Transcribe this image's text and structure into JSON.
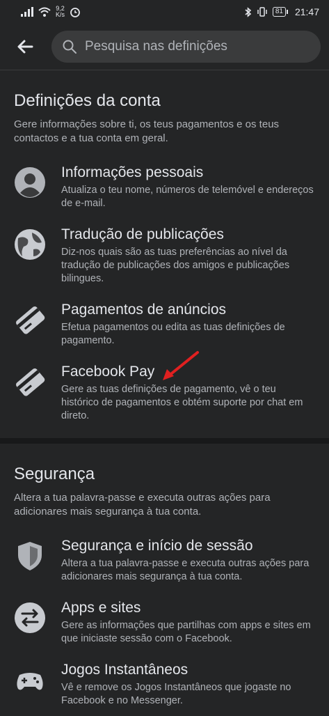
{
  "status": {
    "speed_top": "9,2",
    "speed_bottom": "K/s",
    "battery": "81",
    "time": "21:47"
  },
  "search": {
    "placeholder": "Pesquisa nas definições"
  },
  "sections": [
    {
      "title": "Definições da conta",
      "desc": "Gere informações sobre ti, os teus pagamentos e os teus contactos e a tua conta em geral.",
      "items": [
        {
          "title": "Informações pessoais",
          "desc": "Atualiza o teu nome, números de telemóvel e endereços de e-mail.",
          "icon": "person-icon"
        },
        {
          "title": "Tradução de publicações",
          "desc": "Diz-nos quais são as tuas preferências ao nível da tradução de publicações dos amigos e publicações bilingues.",
          "icon": "globe-icon"
        },
        {
          "title": "Pagamentos de anúncios",
          "desc": "Efetua pagamentos ou edita as tuas definições de pagamento.",
          "icon": "card-icon"
        },
        {
          "title": "Facebook Pay",
          "desc": "Gere as tuas definições de pagamento, vê o teu histórico de pagamentos e obtém suporte por chat em direto.",
          "icon": "card-icon"
        }
      ]
    },
    {
      "title": "Segurança",
      "desc": "Altera a tua palavra-passe e executa outras ações para adicionares mais segurança à tua conta.",
      "items": [
        {
          "title": "Segurança e início de sessão",
          "desc": "Altera a tua palavra-passe e executa outras ações para adicionares mais segurança à tua conta.",
          "icon": "shield-icon"
        },
        {
          "title": "Apps e sites",
          "desc": "Gere as informações que partilhas com apps e sites em que iniciaste sessão com o Facebook.",
          "icon": "swap-arrows-icon"
        },
        {
          "title": "Jogos Instantâneos",
          "desc": "Vê e remove os Jogos Instantâneos que jogaste no Facebook e no Messenger.",
          "icon": "gamepad-icon"
        }
      ]
    }
  ],
  "colors": {
    "background": "#242526",
    "annotation_arrow": "#e02020"
  }
}
